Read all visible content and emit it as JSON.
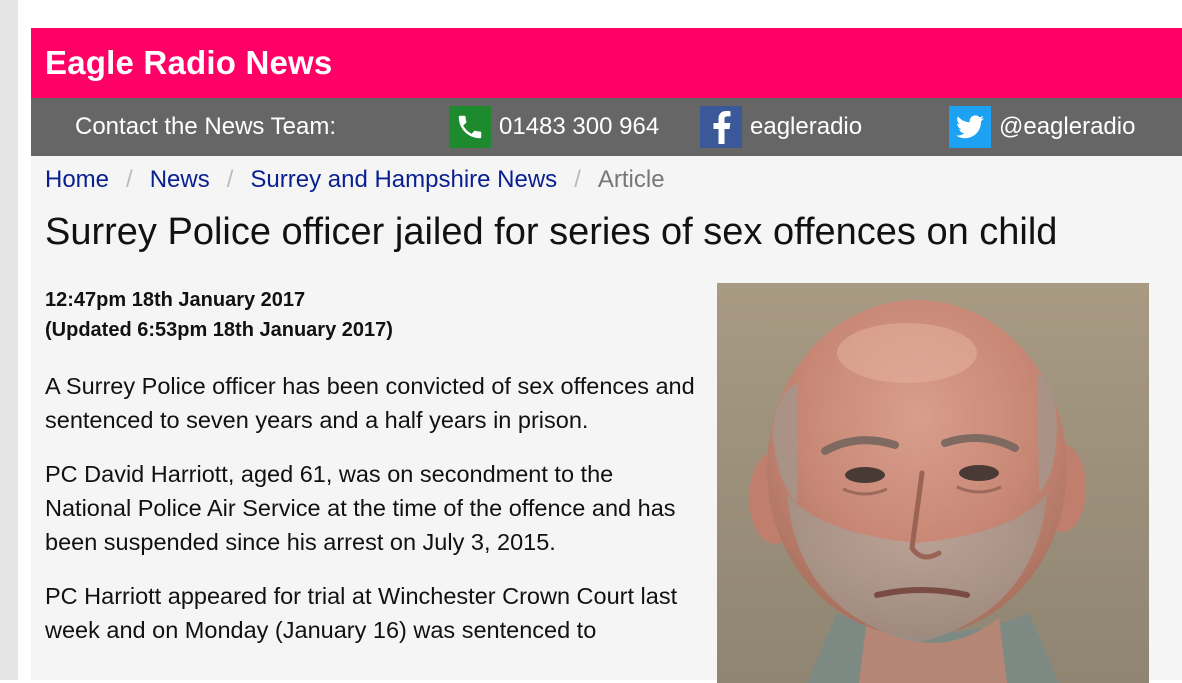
{
  "brand": {
    "title": "Eagle Radio News",
    "color": "#ff0066"
  },
  "contact": {
    "label": "Contact the News Team:",
    "phone": {
      "icon": "phone-icon",
      "text": "01483 300 964"
    },
    "facebook": {
      "icon": "facebook-icon",
      "text": "eagleradio"
    },
    "twitter": {
      "icon": "twitter-icon",
      "text": "@eagleradio"
    }
  },
  "breadcrumb": {
    "items": [
      "Home",
      "News",
      "Surrey and Hampshire News"
    ],
    "current": "Article",
    "separator": "/"
  },
  "article": {
    "headline": "Surrey Police officer jailed for series of sex offences on child",
    "published": "12:47pm 18th January 2017",
    "updated": "(Updated 6:53pm 18th January 2017)",
    "paragraphs": [
      "A Surrey Police officer has been convicted of sex offences and sentenced to seven years and a half years in prison.",
      "PC David Harriott, aged 61, was on secondment to the National Police Air Service at the time of the offence and has been suspended since his arrest on July 3, 2015.",
      "PC Harriott appeared for trial at Winchester Crown Court last week and on Monday (January 16) was sentenced to"
    ]
  }
}
